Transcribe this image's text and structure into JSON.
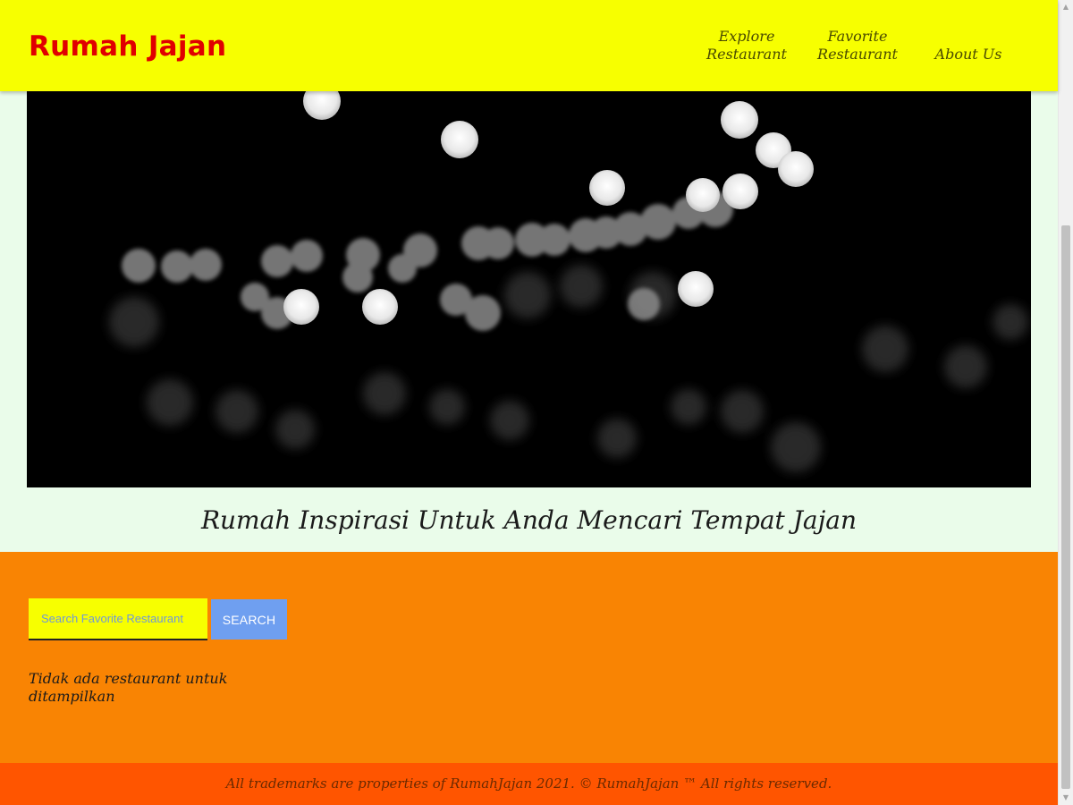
{
  "header": {
    "brand": "Rumah Jajan",
    "nav": [
      {
        "line1": "Explore",
        "line2": "Restaurant"
      },
      {
        "line1": "Favorite",
        "line2": "Restaurant"
      },
      {
        "line1": "About Us",
        "line2": ""
      }
    ]
  },
  "hero": {
    "image": "bokeh-lights-image",
    "tagline": "Rumah Inspirasi Untuk Anda Mencari Tempat Jajan"
  },
  "search": {
    "placeholder": "Search Favorite Restaurant",
    "button_label": "SEARCH"
  },
  "results": {
    "empty_message": "Tidak ada restaurant untuk ditampilkan"
  },
  "footer": {
    "text": "All trademarks are properties of RumahJajan 2021. © RumahJajan ™ All rights reserved."
  },
  "scrollbar": {
    "up_icon": "arrow-up-icon",
    "down_icon": "arrow-down-icon"
  },
  "colors": {
    "header_bg": "#f7ff00",
    "brand": "#e00000",
    "main_bg": "#f98403",
    "footer_bg": "#ff5500",
    "page_bg": "#eafcea",
    "search_button": "#6f9ff0"
  }
}
